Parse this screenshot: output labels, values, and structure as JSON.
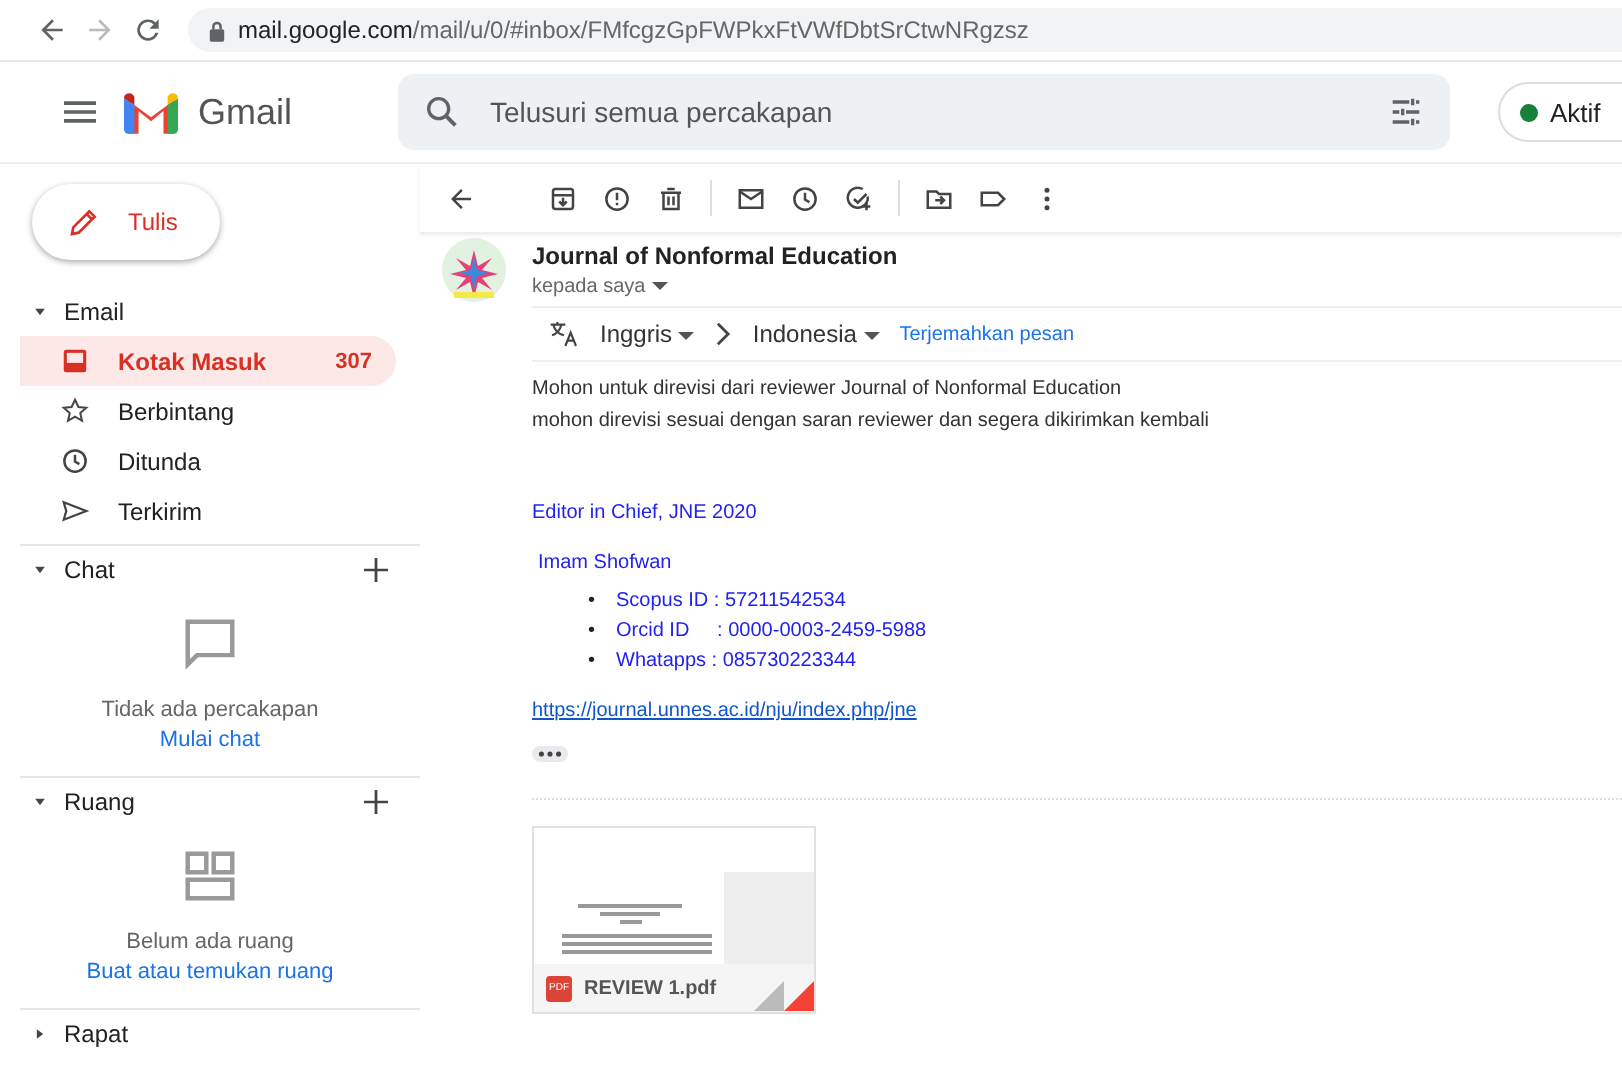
{
  "browser": {
    "host": "mail.google.com",
    "path": "/mail/u/0/#inbox/FMfcgzGpFWPkxFtVWfDbtSrCtwNRgzsz"
  },
  "header": {
    "app_name": "Gmail",
    "search_placeholder": "Telusuri semua percakapan",
    "status": "Aktif"
  },
  "sidebar": {
    "compose": "Tulis",
    "sections": [
      {
        "kind": "folders",
        "title": "Email",
        "expanded": true,
        "items": [
          {
            "label": "Kotak Masuk",
            "count": "307",
            "selected": true
          },
          {
            "label": "Berbintang",
            "selected": false
          },
          {
            "label": "Ditunda",
            "selected": false
          },
          {
            "label": "Terkirim",
            "selected": false
          }
        ]
      },
      {
        "kind": "chat",
        "title": "Chat",
        "expanded": true,
        "empty_text": "Tidak ada percakapan",
        "action": "Mulai chat"
      },
      {
        "kind": "rooms",
        "title": "Ruang",
        "expanded": true,
        "empty_text": "Belum ada ruang",
        "action": "Buat atau temukan ruang"
      },
      {
        "kind": "meet",
        "title": "Rapat",
        "expanded": false
      }
    ]
  },
  "message": {
    "sender": "Journal of Nonformal Education",
    "recipient": "kepada saya",
    "translate": {
      "from": "Inggris",
      "to": "Indonesia",
      "action": "Terjemahkan pesan"
    },
    "body": [
      "Mohon untuk direvisi dari reviewer Journal of Nonformal Education",
      "mohon direvisi sesuai dengan saran reviewer dan segera dikirimkan kembali"
    ],
    "signature": {
      "title": "Editor in Chief, JNE 2020",
      "name": "Imam Shofwan",
      "details": [
        {
          "marker": "•",
          "text": "Scopus ID : 57211542534"
        },
        {
          "marker": "•",
          "text": "Orcid ID     : 0000-0003-2459-5988"
        },
        {
          "marker": "•",
          "text": "Whatapps : 085730223344"
        }
      ],
      "link": "https://journal.unnes.ac.id/nju/index.php/jne"
    },
    "attachment": {
      "filename": "REVIEW 1.pdf",
      "type": "PDF"
    }
  }
}
